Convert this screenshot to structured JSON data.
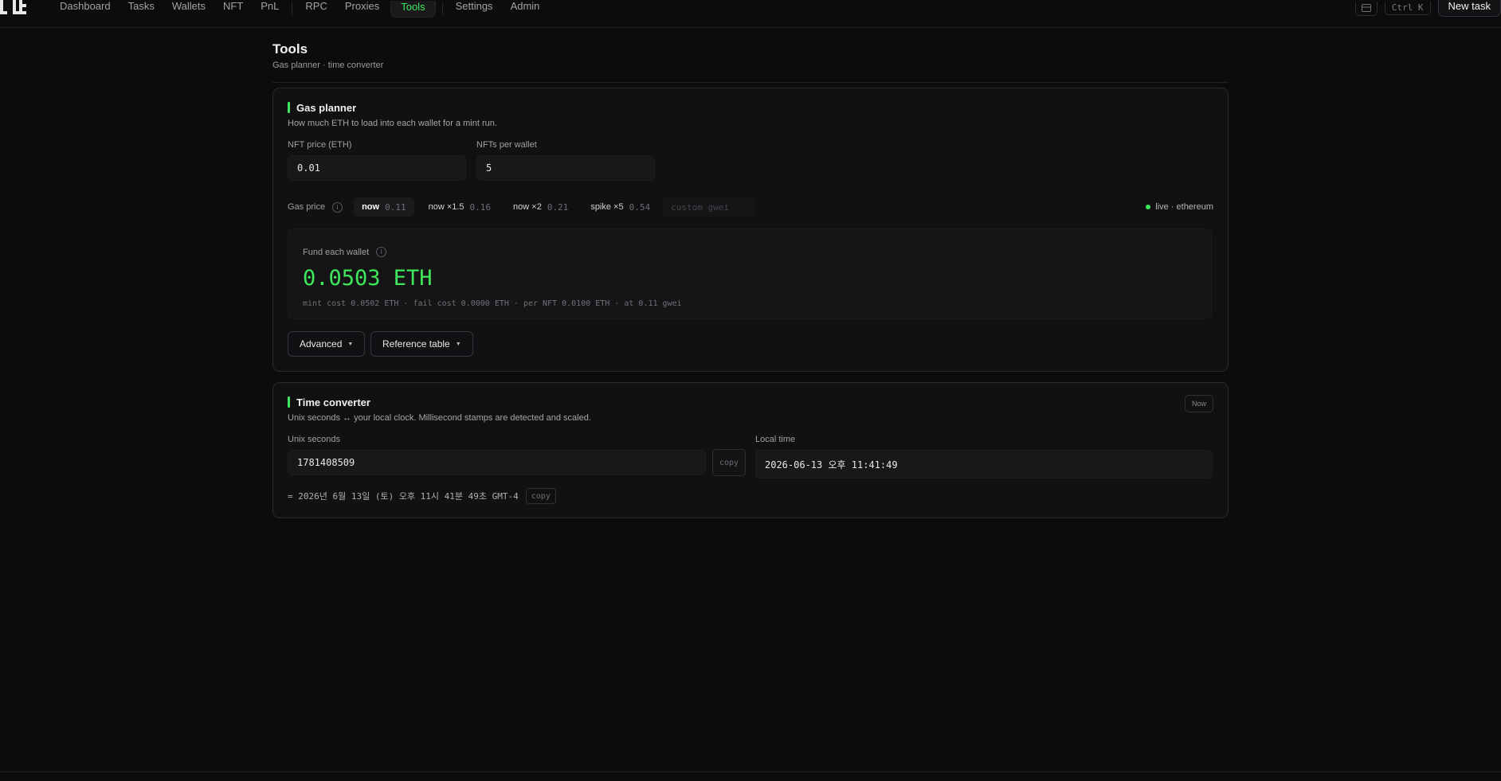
{
  "nav": {
    "items_a": [
      "Dashboard",
      "Tasks",
      "Wallets",
      "NFT",
      "PnL"
    ],
    "items_b": [
      "RPC",
      "Proxies",
      "Tools"
    ],
    "items_c": [
      "Settings",
      "Admin"
    ],
    "active": "Tools",
    "shortcut": "Ctrl K",
    "new_task": "New task",
    "layout_icon": "panel-icon",
    "accent": "#3ee85a"
  },
  "page": {
    "title": "Tools",
    "subtitle": "Gas planner · time converter"
  },
  "gas_planner": {
    "title": "Gas planner",
    "description": "How much ETH to load into each wallet for a mint run.",
    "nft_price_label": "NFT price (ETH)",
    "nft_price_value": "0.01",
    "nfts_per_wallet_label": "NFTs per wallet",
    "nfts_per_wallet_value": "5",
    "gas_price_label": "Gas price",
    "presets": [
      {
        "label": "now",
        "value": "0.11",
        "active": true
      },
      {
        "label": "now ×1.5",
        "value": "0.16",
        "active": false
      },
      {
        "label": "now ×2",
        "value": "0.21",
        "active": false
      },
      {
        "label": "spike ×5",
        "value": "0.54",
        "active": false
      }
    ],
    "custom_placeholder": "custom gwei",
    "live_status": "live · ethereum",
    "fund_label": "Fund each wallet",
    "fund_value": "0.0503 ETH",
    "fund_detail": "mint cost 0.0502 ETH · fail cost 0.0000 ETH · per NFT 0.0100 ETH · at 0.11 gwei",
    "advanced_label": "Advanced",
    "reference_label": "Reference table"
  },
  "time_converter": {
    "title": "Time converter",
    "description": "Unix seconds ↔ your local clock. Millisecond stamps are detected and scaled.",
    "now_label": "Now",
    "unix_label": "Unix seconds",
    "unix_value": "1781408509",
    "copy_label": "copy",
    "local_label": "Local time",
    "local_value": "2026-06-13 오후 11:41:49",
    "result_text": "= 2026년 6월 13일 (토) 오후 11시 41분 49초 GMT-4"
  }
}
